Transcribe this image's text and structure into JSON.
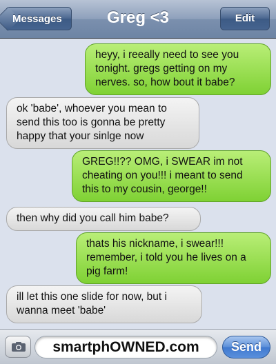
{
  "navbar": {
    "back_label": "Messages",
    "title": "Greg <3",
    "edit_label": "Edit"
  },
  "messages": [
    {
      "direction": "sent",
      "text": "heyy, i reeally need to see you tonight. gregs getting on my nerves. so, how bout it babe?"
    },
    {
      "direction": "received",
      "text": "ok 'babe', whoever you mean to send this too is gonna be pretty happy that your sinlge now"
    },
    {
      "direction": "sent",
      "text": "GREG!!?? OMG, i SWEAR im not cheating on you!!! i meant to send this to my cousin, george!!"
    },
    {
      "direction": "received",
      "text": "then why did you call him babe?"
    },
    {
      "direction": "sent",
      "text": "thats his nickname, i swear!!! remember, i told you he lives on a pig farm!"
    },
    {
      "direction": "received",
      "text": "ill let this one slide for now, but i wanna meet 'babe'"
    }
  ],
  "composer": {
    "input_text": "smartphOWNED.com",
    "send_label": "Send",
    "camera_icon": "camera-icon"
  },
  "colors": {
    "sent_bubble": "#8fdc45",
    "received_bubble": "#e5e5e5",
    "background": "#dbe1ed",
    "send_button": "#4a82d4"
  }
}
